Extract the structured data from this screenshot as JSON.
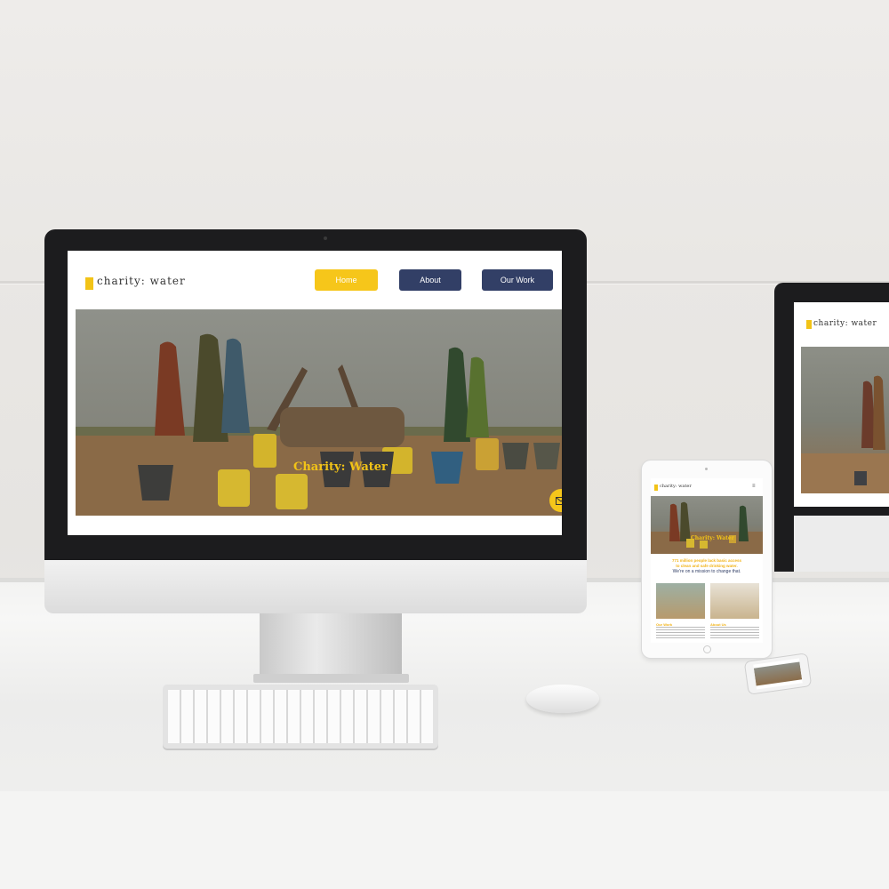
{
  "site": {
    "logo_text": "charity: water",
    "nav": [
      {
        "label": "Home",
        "active": true
      },
      {
        "label": "About",
        "active": false
      },
      {
        "label": "Our Work",
        "active": false
      }
    ],
    "hero_title": "Charity: Water",
    "icons": {
      "contact": "mail-icon",
      "menu": "hamburger-icon"
    },
    "colors": {
      "accent": "#f6c61a",
      "nav_dark": "#323f66"
    }
  },
  "tablet": {
    "logo_text": "charity: water",
    "hero_title": "Charity: Water",
    "stat_line1": "771 million people lack basic access",
    "stat_line2": "to clean and safe drinking water.",
    "mission": "We're on a mission to change that.",
    "card1_label": "Our Work",
    "card2_label": "About Us"
  }
}
